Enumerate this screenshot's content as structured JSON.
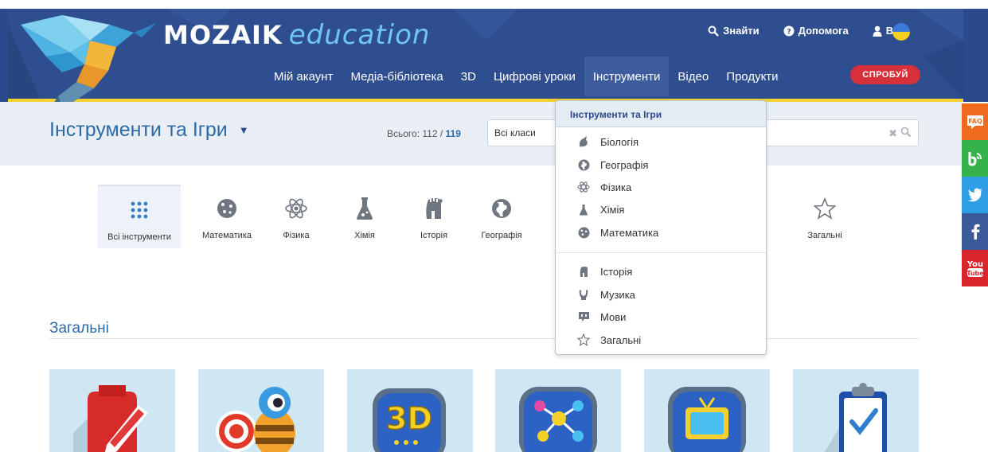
{
  "header": {
    "logo_main": "MOZAIK",
    "logo_sub": "education",
    "top_links": [
      {
        "label": "Знайти",
        "icon": "search-icon"
      },
      {
        "label": "Допомога",
        "icon": "help-icon"
      },
      {
        "label": "Вхід",
        "icon": "user-icon"
      }
    ],
    "nav": [
      {
        "label": "Мій акаунт"
      },
      {
        "label": "Медіа-бібліотека"
      },
      {
        "label": "3D"
      },
      {
        "label": "Цифрові уроки"
      },
      {
        "label": "Інструменти",
        "active": true
      },
      {
        "label": "Відео"
      },
      {
        "label": "Продукти"
      }
    ],
    "try_label": "СПРОБУЙ"
  },
  "titlebar": {
    "title": "Інструменти та Ігри",
    "total_label": "Всього: 112 / ",
    "total_value": "119",
    "grade_select": "Всі класи"
  },
  "categories": [
    {
      "label": "Всі інструменти",
      "icon": "grid-icon",
      "active": true
    },
    {
      "label": "Математика",
      "icon": "dice-icon"
    },
    {
      "label": "Фізика",
      "icon": "atom-icon"
    },
    {
      "label": "Хімія",
      "icon": "flask-icon"
    },
    {
      "label": "Історія",
      "icon": "helmet-icon"
    },
    {
      "label": "Географія",
      "icon": "globe-icon"
    },
    {
      "label": "Загальні",
      "icon": "star-icon"
    }
  ],
  "section": {
    "title": "Загальні"
  },
  "dropdown": {
    "header": "Інструменти та Ігри",
    "items": [
      {
        "label": "Біологія",
        "icon": "biology-icon"
      },
      {
        "label": "Географія",
        "icon": "globe-icon"
      },
      {
        "label": "Фізика",
        "icon": "atom-icon"
      },
      {
        "label": "Хімія",
        "icon": "flask-icon"
      },
      {
        "label": "Математика",
        "icon": "dice-icon"
      },
      {
        "label": "Історія",
        "icon": "helmet-icon"
      },
      {
        "label": "Музика",
        "icon": "lyre-icon"
      },
      {
        "label": "Мови",
        "icon": "speech-icon"
      },
      {
        "label": "Загальні",
        "icon": "star-icon"
      }
    ]
  },
  "social": [
    {
      "label": "FAQ",
      "color": "#f06a1e"
    },
    {
      "label": "b",
      "color": "#35b34a"
    },
    {
      "label": "twitter",
      "color": "#2e9fe6"
    },
    {
      "label": "f",
      "color": "#3b5a9a"
    },
    {
      "label": "You Tube",
      "color": "#d9262c"
    }
  ],
  "colors": {
    "header": "#2f4e90",
    "accent": "#2d6aa8",
    "try_button": "#d6303a",
    "yellow": "#f1d230"
  }
}
